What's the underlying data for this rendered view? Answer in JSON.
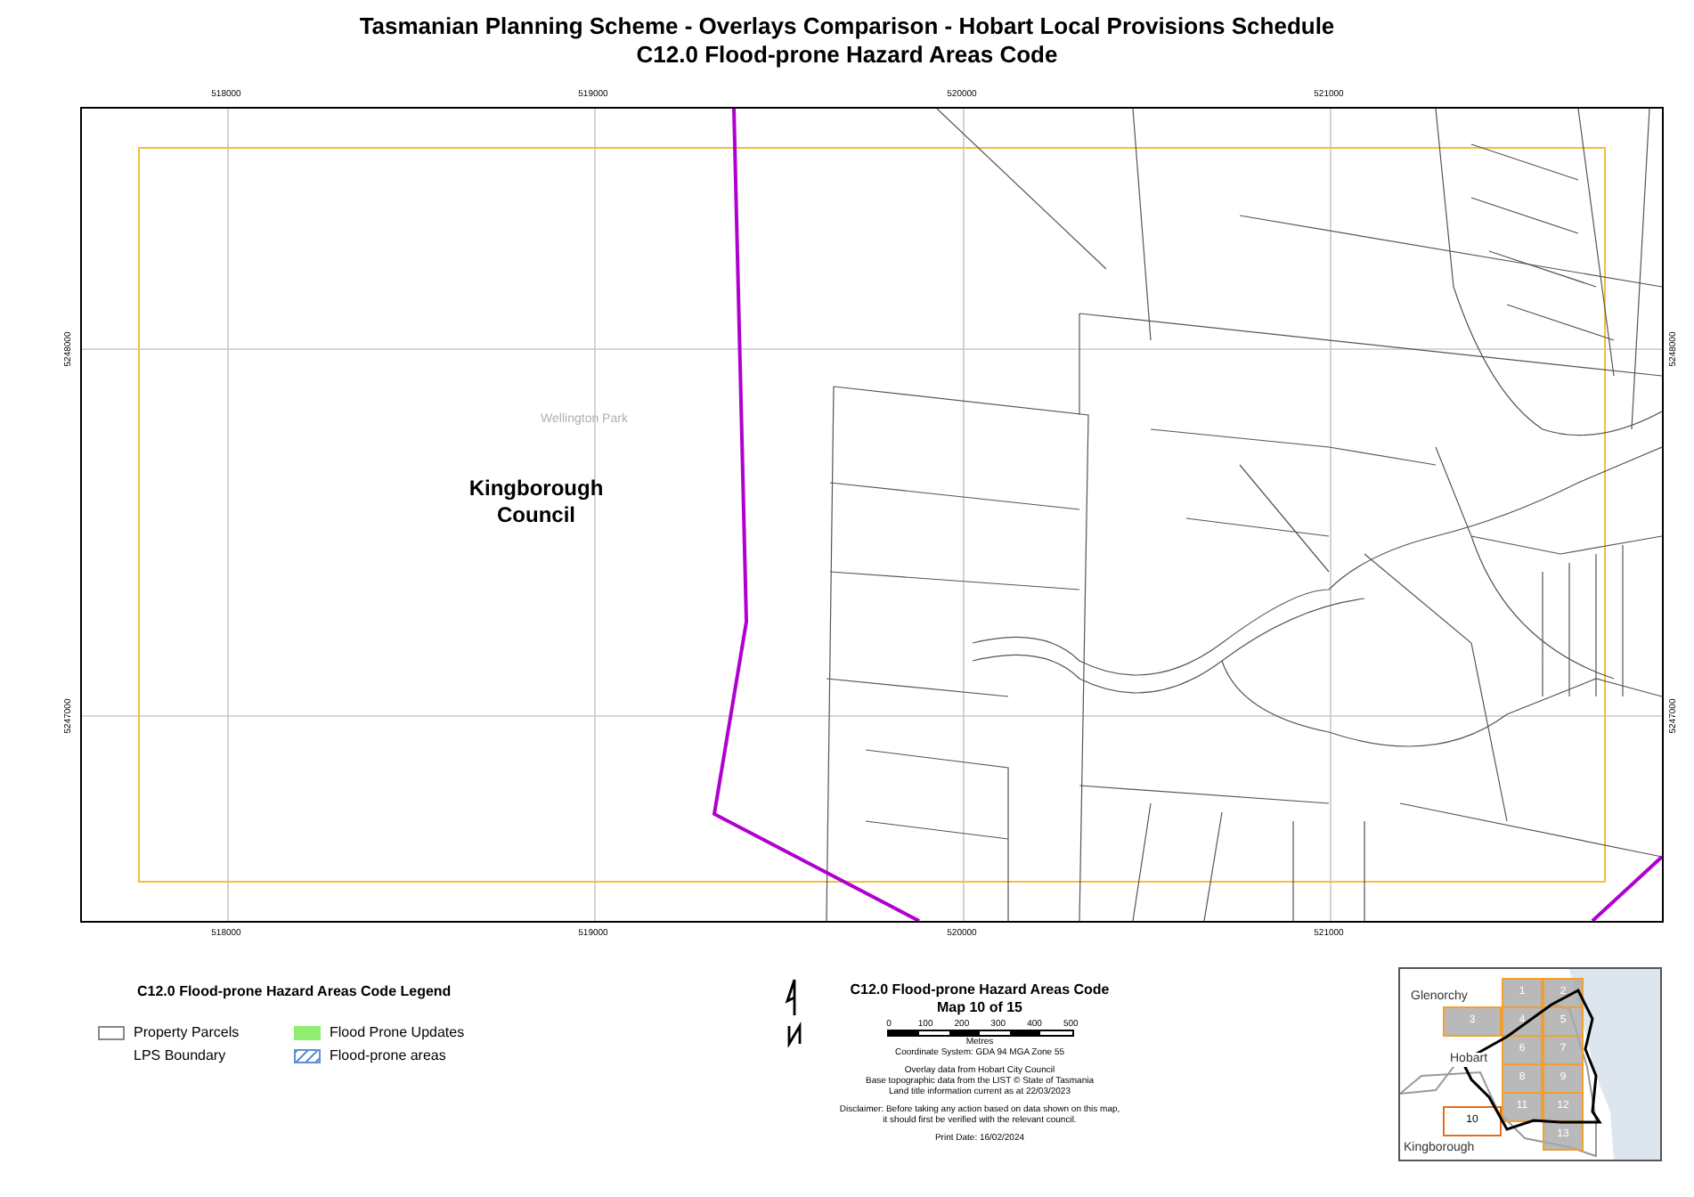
{
  "title": {
    "line_1": "Tasmanian Planning Scheme - Overlays Comparison - Hobart Local Provisions Schedule",
    "line_2": "C12.0 Flood-prone Hazard Areas Code"
  },
  "map": {
    "top_ticks": [
      "518000",
      "519000",
      "520000",
      "521000"
    ],
    "bottom_ticks": [
      "518000",
      "519000",
      "520000",
      "521000"
    ],
    "left_ticks": [
      "5248000",
      "5247000"
    ],
    "right_ticks": [
      "5248000",
      "5247000"
    ],
    "council_label": "Kingborough Council",
    "place_label": "Wellington Park"
  },
  "legend": {
    "title": "C12.0 Flood-prone Hazard Areas Code Legend",
    "items": [
      {
        "kind": "parcel",
        "label": "Property Parcels"
      },
      {
        "kind": "update",
        "label": "Flood Prone Updates"
      },
      {
        "kind": "boundary",
        "label": "LPS Boundary"
      },
      {
        "kind": "hatch",
        "label": "Flood-prone areas"
      }
    ]
  },
  "info": {
    "title": "C12.0 Flood-prone Hazard Areas Code",
    "subtitle": "Map 10 of 15",
    "scale_labels": [
      "0",
      "100",
      "200",
      "300",
      "400",
      "500"
    ],
    "scale_unit": "Metres",
    "coordinate_system": "Coordinate System: GDA 94 MGA Zone 55",
    "notes": [
      "Overlay data from Hobart City Council",
      "Base topographic data from the LIST © State of Tasmania",
      "Land title information current as at 22/03/2023"
    ],
    "disclaimer": [
      "Disclaimer: Before taking any action based on data shown on this map,",
      "it should first be verified with the relevant council."
    ],
    "print_date": "Print Date: 16/02/2024"
  },
  "inset": {
    "labels": [
      "Glenorchy",
      "Hobart",
      "Kingborough"
    ],
    "tiles": [
      {
        "label": "1",
        "selected": false
      },
      {
        "label": "2",
        "selected": false
      },
      {
        "label": "3",
        "selected": false
      },
      {
        "label": "4",
        "selected": false
      },
      {
        "label": "5",
        "selected": false
      },
      {
        "label": "6",
        "selected": false
      },
      {
        "label": "7",
        "selected": false
      },
      {
        "label": "8",
        "selected": false
      },
      {
        "label": "9",
        "selected": false
      },
      {
        "label": "10",
        "selected": true
      },
      {
        "label": "11",
        "selected": false
      },
      {
        "label": "12",
        "selected": false
      },
      {
        "label": "13",
        "selected": false
      }
    ]
  }
}
